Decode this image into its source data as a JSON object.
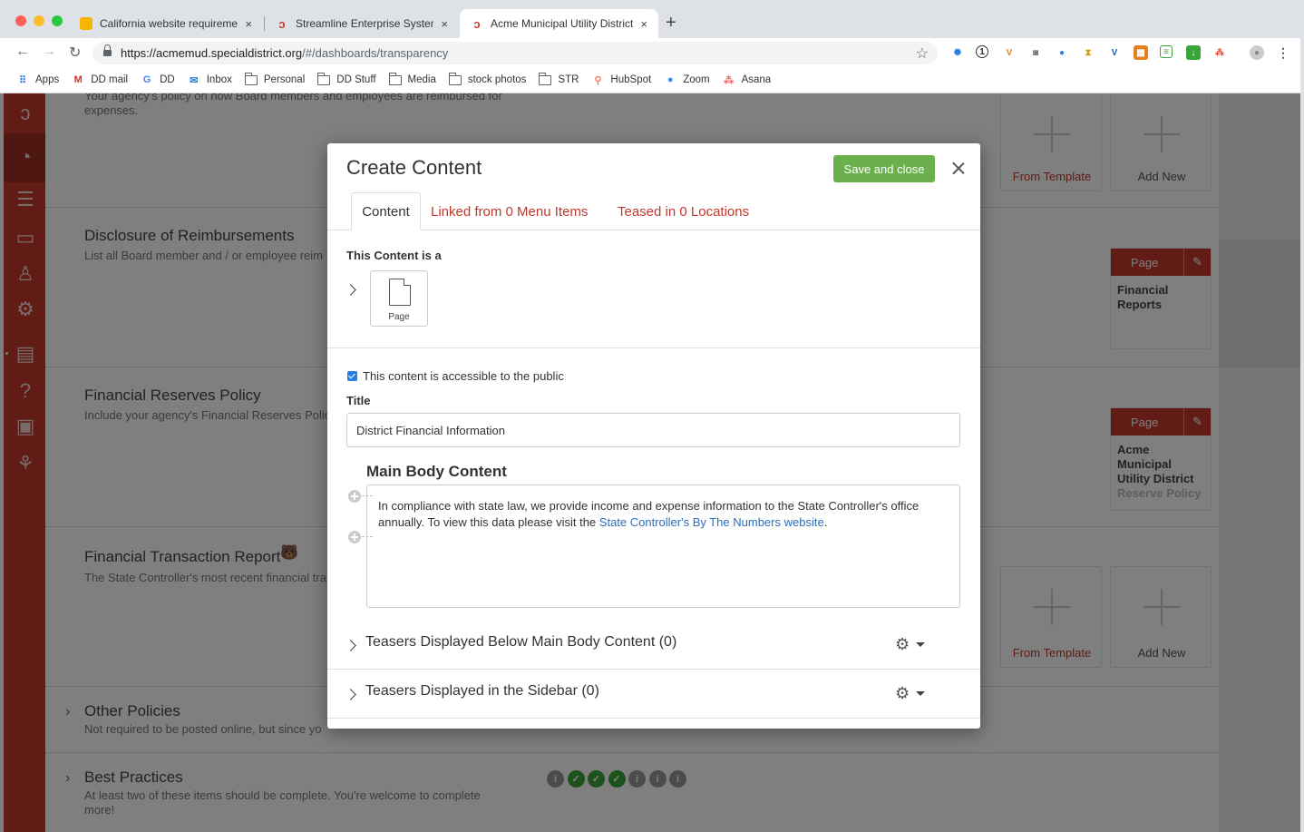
{
  "browser": {
    "tabs": [
      {
        "label": "California website requirement",
        "close": "×",
        "favicon_color": "#f4b400"
      },
      {
        "label": "Streamline Enterprise System",
        "close": "×",
        "favicon_color": "#c0392b"
      },
      {
        "label": "Acme Municipal Utility District",
        "close": "×",
        "favicon_color": "#c0392b"
      }
    ],
    "new_tab": "+",
    "url_host": "https://acmemud.specialdistrict.org",
    "url_path": "/#/dashboards/transparency",
    "bookmarks": [
      {
        "label": "Apps",
        "icon": "apps-grid-icon"
      },
      {
        "label": "DD mail",
        "icon": "gmail-icon"
      },
      {
        "label": "DD",
        "icon": "google-icon"
      },
      {
        "label": "Inbox",
        "icon": "inbox-icon"
      },
      {
        "label": "Personal",
        "icon": "folder-icon"
      },
      {
        "label": "DD Stuff",
        "icon": "folder-icon"
      },
      {
        "label": "Media",
        "icon": "folder-icon"
      },
      {
        "label": "stock photos",
        "icon": "folder-icon"
      },
      {
        "label": "STR",
        "icon": "folder-icon"
      },
      {
        "label": "HubSpot",
        "icon": "hubspot-icon"
      },
      {
        "label": "Zoom",
        "icon": "zoom-icon"
      },
      {
        "label": "Asana",
        "icon": "asana-icon"
      }
    ]
  },
  "background": {
    "sections": [
      {
        "title": "",
        "desc": "Your agency's policy on how Board members and employees are reimbursed for",
        "desc2": "expenses."
      },
      {
        "title": "Disclosure of Reimbursements",
        "desc": "List all Board member and / or employee reim"
      },
      {
        "title": "Financial Reserves Policy",
        "desc": "Include your agency's Financial Reserves Polic"
      },
      {
        "title": "Financial Transaction Report",
        "desc": "The State Controller's most recent financial tra"
      },
      {
        "title": "Other Policies",
        "desc": "Not required to be posted online, but since yo"
      },
      {
        "title": "Best Practices",
        "desc": "At least two of these items should be complete. You're welcome to complete",
        "desc2": "more!"
      }
    ],
    "from_template": "From Template",
    "add_new": "Add New",
    "page_cards": [
      {
        "header": "Page",
        "lines": [
          "Financial",
          "Reports"
        ]
      },
      {
        "header": "Page",
        "lines": [
          "Acme",
          "Municipal",
          "Utility District"
        ],
        "sub": "Reserve Policy"
      }
    ],
    "progress": [
      "i",
      "✓",
      "✓",
      "✓",
      "i",
      "i",
      "i"
    ]
  },
  "modal": {
    "title": "Create Content",
    "save_label": "Save and close",
    "tabs": {
      "content": "Content",
      "linked": "Linked from 0 Menu Items",
      "teased": "Teased in 0 Locations"
    },
    "content_is_a": "This Content is a",
    "type_label": "Page",
    "public_checkbox": "This content is accessible to the public",
    "title_label": "Title",
    "title_value": "District Financial Information",
    "body_label": "Main Body Content",
    "body_text": "In compliance with state law, we provide income and expense information to the State Controller's office annually. To view this data please visit the ",
    "body_link": "State Controller's By The Numbers website",
    "body_end": ".",
    "teaser_rows": [
      {
        "label": "Teasers Displayed Below Main Body Content (0)"
      },
      {
        "label": "Teasers Displayed in the Sidebar (0)"
      }
    ]
  }
}
